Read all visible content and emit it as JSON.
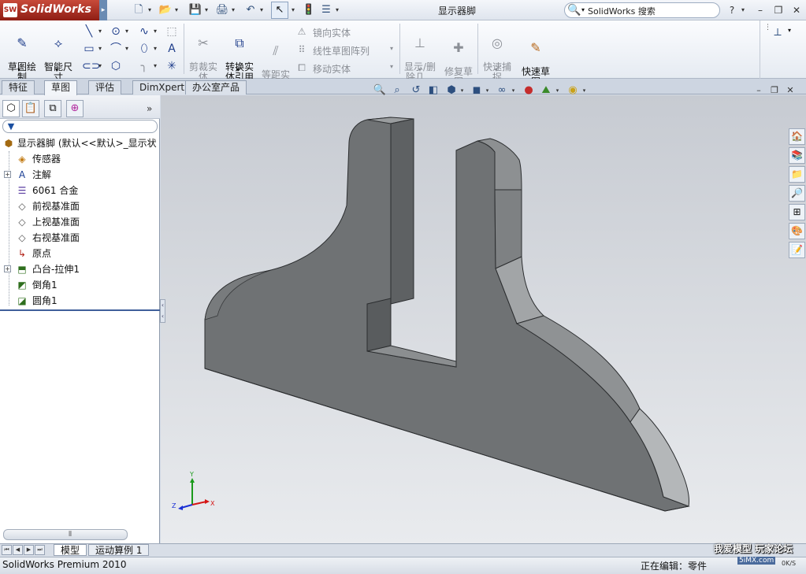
{
  "app": {
    "logo_text": "SolidWorks",
    "logo_badge": "SW",
    "document_title": "显示器脚",
    "search_placeholder": "SolidWorks 搜索",
    "help_label": "?",
    "menu_arrow": "▸"
  },
  "command_manager": {
    "sketch": "草图绘\n制",
    "smart_dim": "智能尺\n寸",
    "trim": "剪裁实\n体",
    "convert": "转换实\n体引用",
    "offset": "等距实\n体",
    "mirror": "镜向实体",
    "linear_pattern": "线性草图阵列",
    "move": "移动实体",
    "show_delete": "显示/删\n除几…",
    "repair": "修复草\n图",
    "quick_snap": "快速捕\n捉",
    "rapid_sketch": "快速草\n图"
  },
  "tabs": [
    "特征",
    "草图",
    "评估",
    "DimXpert",
    "办公室产品"
  ],
  "active_tab": 1,
  "feature_tree": {
    "root": "显示器脚 (默认<<默认>_显示状",
    "items": [
      {
        "label": "传感器",
        "icon": "sensor-icon",
        "expandable": false
      },
      {
        "label": "注解",
        "icon": "annotation-icon",
        "expandable": true
      },
      {
        "label": "6061 合金",
        "icon": "material-icon",
        "expandable": false
      },
      {
        "label": "前视基准面",
        "icon": "plane-icon",
        "expandable": false
      },
      {
        "label": "上视基准面",
        "icon": "plane-icon",
        "expandable": false
      },
      {
        "label": "右视基准面",
        "icon": "plane-icon",
        "expandable": false
      },
      {
        "label": "原点",
        "icon": "origin-icon",
        "expandable": false
      },
      {
        "label": "凸台-拉伸1",
        "icon": "extrude-icon",
        "expandable": true
      },
      {
        "label": "倒角1",
        "icon": "chamfer-icon",
        "expandable": false
      },
      {
        "label": "圆角1",
        "icon": "fillet-icon",
        "expandable": false
      }
    ]
  },
  "bottom_tabs": [
    "模型",
    "运动算例 1"
  ],
  "status": {
    "app_version": "SolidWorks Premium 2010",
    "editing": "正在编辑：零件",
    "watermark": "我爱模型 玩家论坛",
    "watermark_url": "5iMX.com",
    "speed": "0K/S"
  },
  "triad": {
    "x": "X",
    "y": "Y",
    "z": "Z"
  },
  "colors": {
    "model_face": "#6b6e70",
    "model_edge": "#2b2d2f",
    "viewport_top": "#c7cbd2",
    "viewport_bottom": "#e9ebee",
    "logo_red": "#b0261b"
  }
}
